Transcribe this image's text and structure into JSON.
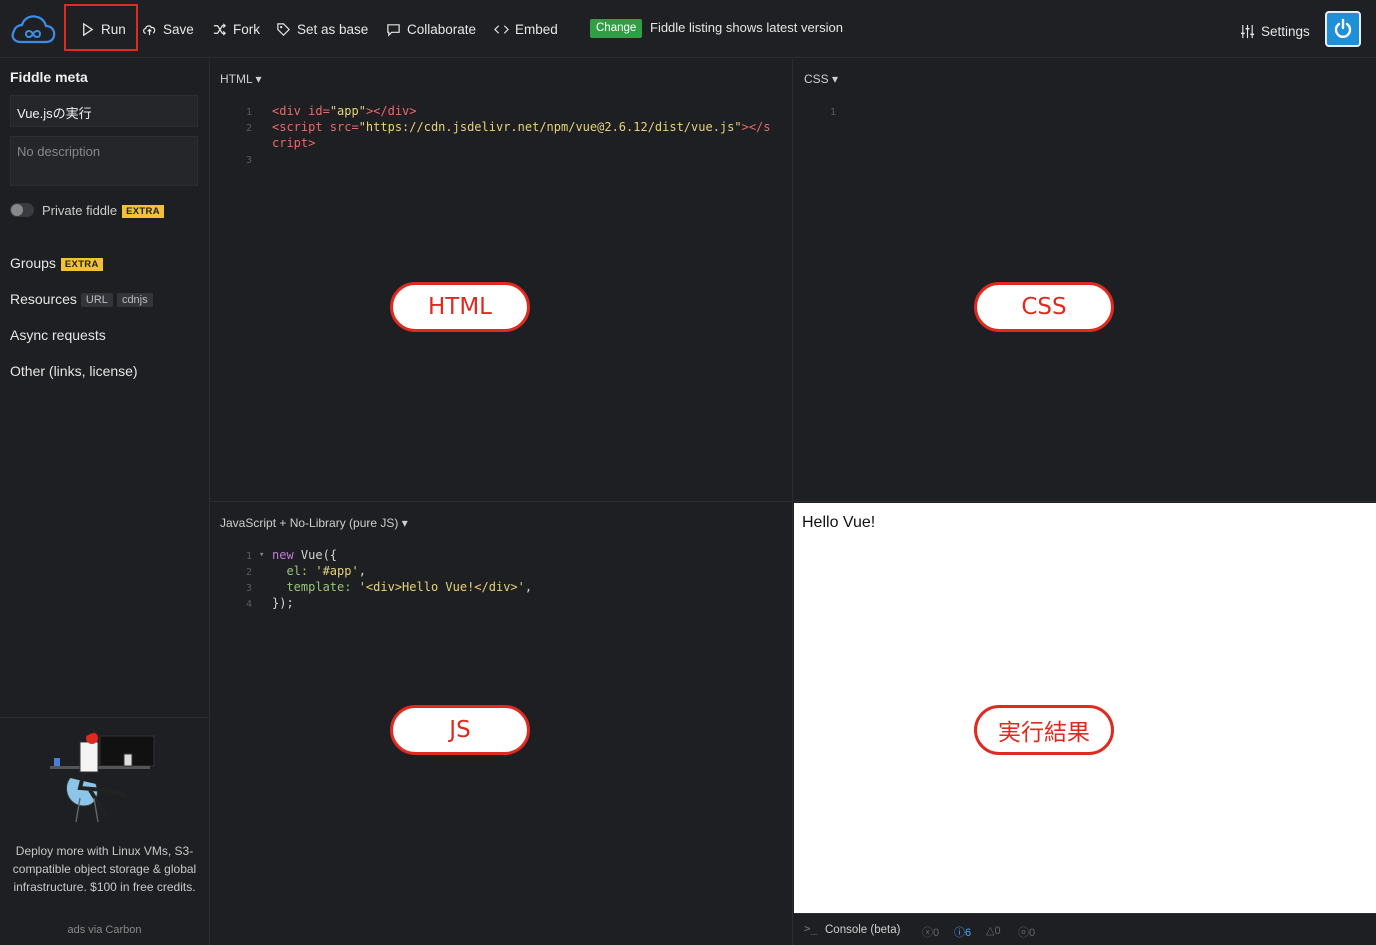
{
  "toolbar": {
    "run_label": "Run",
    "save_label": "Save",
    "fork_label": "Fork",
    "set_base_label": "Set as base",
    "collaborate_label": "Collaborate",
    "embed_label": "Embed",
    "change_badge": "Change",
    "change_text": "Fiddle listing shows latest version",
    "settings_label": "Settings"
  },
  "sidebar": {
    "title": "Fiddle meta",
    "name_value": "Vue.jsの実行",
    "description_placeholder": "No description",
    "private_label": "Private fiddle",
    "extra_badge": "EXTRA",
    "groups_label": "Groups",
    "resources_label": "Resources",
    "resources_badges": [
      "URL",
      "cdnjs"
    ],
    "async_label": "Async requests",
    "other_label": "Other (links, license)",
    "ad_text": "Deploy more with Linux VMs, S3-compatible object storage & global infrastructure. $100 in free credits.",
    "ad_via": "ads via Carbon"
  },
  "panels": {
    "html_head": "HTML ▾",
    "css_head": "CSS ▾",
    "js_head": "JavaScript + No-Library (pure JS) ▾",
    "html_label": "HTML",
    "css_label": "CSS",
    "js_label": "JS",
    "result_label": "実行結果",
    "result_text": "Hello Vue!"
  },
  "html_code": {
    "lines": [
      "1",
      "2",
      "3"
    ],
    "l1_open": "<div",
    "l1_attr": " id=",
    "l1_val": "\"app\"",
    "l1_close": "></div>",
    "l2_open": "<script",
    "l2_attr": " src=",
    "l2_val": "\"https://cdn.jsdelivr.net/npm/vue@2.6.12/dist/vue.js\"",
    "l2_close": "></s",
    "l2b": "cript>"
  },
  "css_code": {
    "lines": [
      "1"
    ]
  },
  "js_code": {
    "lines": [
      "1",
      "2",
      "3",
      "4"
    ],
    "l1_kw": "new",
    "l1_rest": " Vue({",
    "l2_prop": "  el:",
    "l2_val": " '#app'",
    "l2_end": ",",
    "l3_prop": "  template:",
    "l3_val": " '<div>Hello Vue!</div>'",
    "l3_end": ",",
    "l4": "});"
  },
  "console": {
    "label": "Console (beta)",
    "counts": [
      "0",
      "6",
      "0",
      "0"
    ]
  },
  "colors": {
    "accent_red": "#e0291f",
    "change_green": "#2f9e44",
    "power_blue": "#1e90d8"
  }
}
